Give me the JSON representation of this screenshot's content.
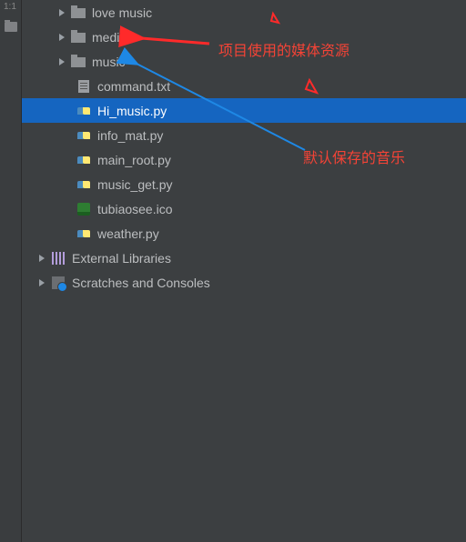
{
  "gutter_label": "1:1",
  "tree": {
    "items": [
      {
        "label": "love music",
        "indent": 40,
        "icon": "folder",
        "chevron": "right",
        "selected": false
      },
      {
        "label": "media",
        "indent": 40,
        "icon": "folder",
        "chevron": "right",
        "selected": false
      },
      {
        "label": "music",
        "indent": 40,
        "icon": "folder",
        "chevron": "right",
        "selected": false
      },
      {
        "label": "command.txt",
        "indent": 60,
        "icon": "text",
        "chevron": "",
        "selected": false
      },
      {
        "label": "Hi_music.py",
        "indent": 60,
        "icon": "py",
        "chevron": "",
        "selected": true
      },
      {
        "label": "info_mat.py",
        "indent": 60,
        "icon": "py",
        "chevron": "",
        "selected": false
      },
      {
        "label": "main_root.py",
        "indent": 60,
        "icon": "py",
        "chevron": "",
        "selected": false
      },
      {
        "label": "music_get.py",
        "indent": 60,
        "icon": "py",
        "chevron": "",
        "selected": false
      },
      {
        "label": "tubiaosee.ico",
        "indent": 60,
        "icon": "ico",
        "chevron": "",
        "selected": false
      },
      {
        "label": "weather.py",
        "indent": 60,
        "icon": "py",
        "chevron": "",
        "selected": false
      },
      {
        "label": "External Libraries",
        "indent": 18,
        "icon": "libs",
        "chevron": "right",
        "selected": false
      },
      {
        "label": "Scratches and Consoles",
        "indent": 18,
        "icon": "scr",
        "chevron": "right",
        "selected": false
      }
    ]
  },
  "annotations": {
    "a0": "项目使用的媒体资源",
    "a1": "默认保存的音乐"
  },
  "colors": {
    "selection": "#1565c0",
    "annotation": "#f44336",
    "arrow1": "#ff2a2a",
    "arrow2": "#1e88e5"
  }
}
